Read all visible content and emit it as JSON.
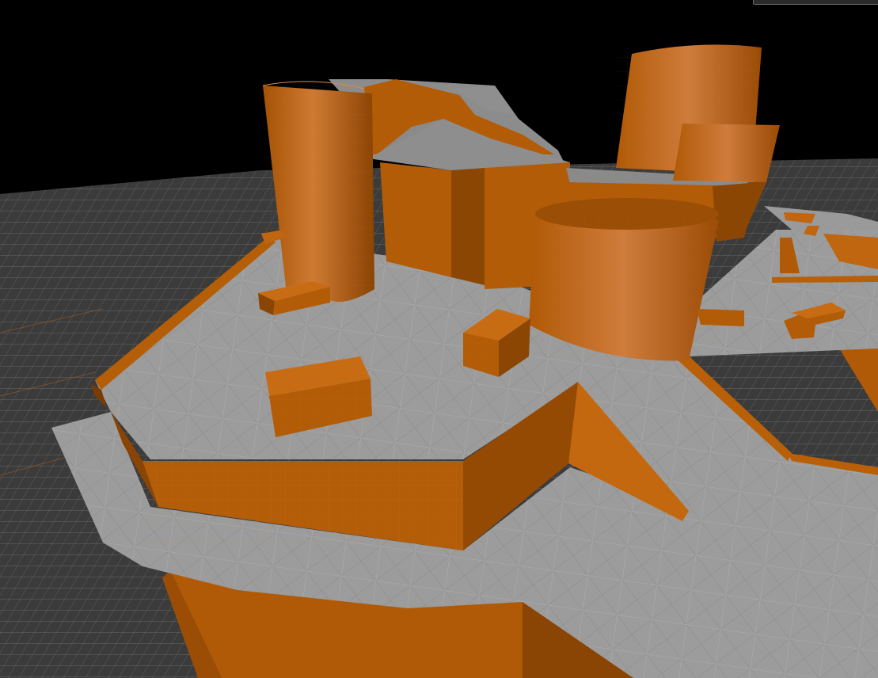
{
  "viewport": {
    "background": "#000000"
  },
  "colors": {
    "orange": "#b8610a",
    "orange_light": "#d07020",
    "orange_dark": "#7f3f03",
    "floor_gray": "#9a9a9a",
    "floor_gray_dark": "#6f6f6f",
    "grid_line": "#bdbdbd",
    "grid_accent": "#b05a14"
  },
  "corner_widget": {
    "icon": "viewport-options-icon"
  }
}
